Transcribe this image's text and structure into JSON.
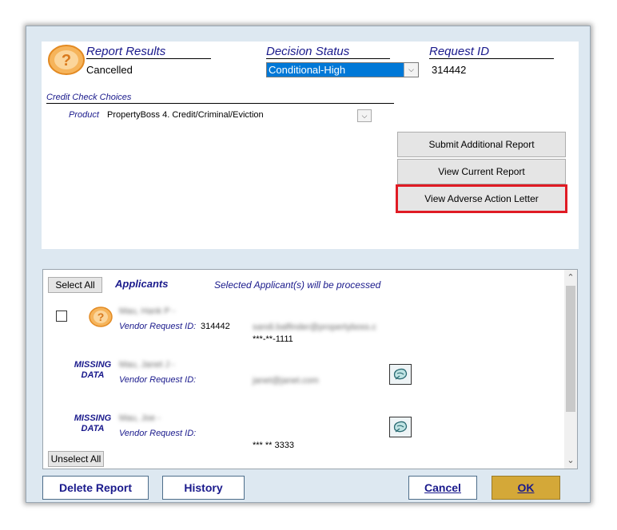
{
  "header": {
    "report_results_label": "Report Results",
    "report_results_value": "Cancelled",
    "decision_status_label": "Decision Status",
    "decision_status_value": "Conditional-High",
    "request_id_label": "Request ID",
    "request_id_value": "314442"
  },
  "credit_check": {
    "title": "Credit Check Choices",
    "product_label": "Product",
    "product_value": "PropertyBoss 4. Credit/Criminal/Eviction"
  },
  "actions": {
    "submit_additional": "Submit Additional Report",
    "view_current": "View Current Report",
    "view_adverse": "View Adverse Action Letter"
  },
  "applicants": {
    "select_all": "Select All",
    "title": "Applicants",
    "note": "Selected Applicant(s) will be processed",
    "unselect_all": "Unselect All",
    "vendor_label": "Vendor Request ID:",
    "missing_line1": "MISSING",
    "missing_line2": "DATA",
    "rows": [
      {
        "name": "Mau, Hank P -",
        "vendor_id": "314442",
        "email": "sandi.balfinder@propertyboss.c",
        "ssn": "***-**-1111"
      },
      {
        "name": "Mau, Janet J -",
        "vendor_id": "",
        "email": "janet@janet.com",
        "ssn": ""
      },
      {
        "name": "Mau, Joe -",
        "vendor_id": "",
        "email": "",
        "ssn": "*** ** 3333"
      }
    ]
  },
  "footer": {
    "delete_report": "Delete Report",
    "history": "History",
    "cancel": "Cancel",
    "ok": "OK"
  },
  "colors": {
    "accent_blue": "#1a1a8c",
    "selection": "#0078d7",
    "ok_button": "#d4a838",
    "highlight": "#e01b24"
  }
}
